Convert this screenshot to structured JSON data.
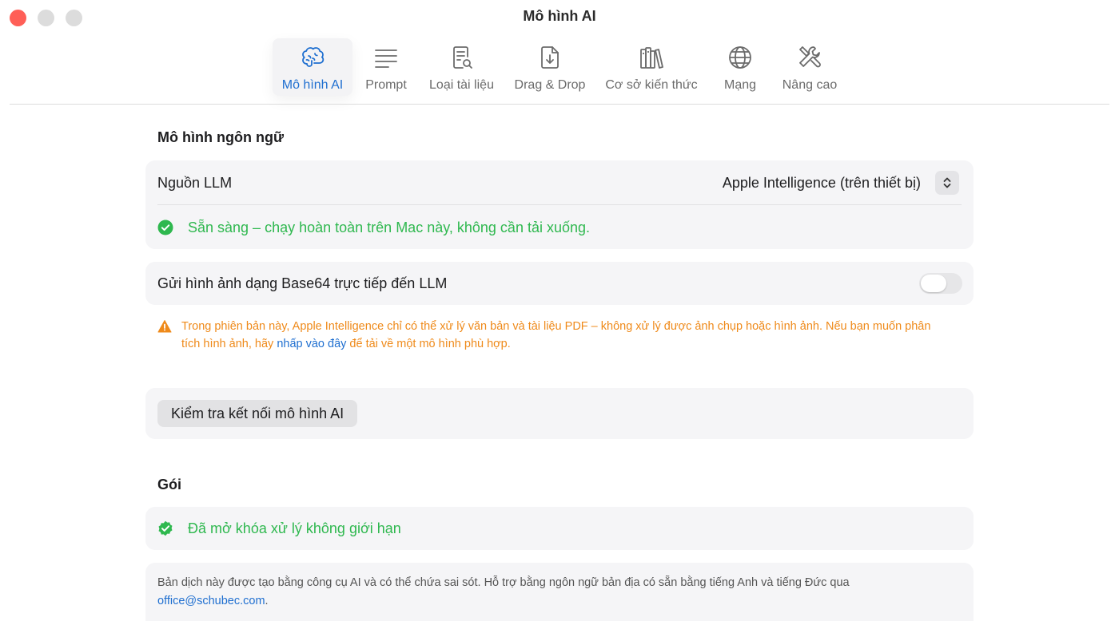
{
  "window": {
    "title": "Mô hình AI"
  },
  "toolbar": {
    "tabs": [
      {
        "label": "Mô hình AI",
        "icon": "brain-icon",
        "active": true
      },
      {
        "label": "Prompt",
        "icon": "text-lines-icon",
        "active": false
      },
      {
        "label": "Loại tài liệu",
        "icon": "document-search-icon",
        "active": false
      },
      {
        "label": "Drag & Drop",
        "icon": "document-download-icon",
        "active": false
      },
      {
        "label": "Cơ sở kiến thức",
        "icon": "books-icon",
        "active": false
      },
      {
        "label": "Mạng",
        "icon": "globe-icon",
        "active": false
      },
      {
        "label": "Nâng cao",
        "icon": "tools-icon",
        "active": false
      }
    ]
  },
  "language_model": {
    "section_title": "Mô hình ngôn ngữ",
    "llm_source_label": "Nguồn LLM",
    "llm_source_value": "Apple Intelligence (trên thiết bị)",
    "status_text": "Sẵn sàng – chạy hoàn toàn trên Mac này, không cần tải xuống.",
    "base64_label": "Gửi hình ảnh dạng Base64 trực tiếp đến LLM",
    "base64_enabled": false,
    "warning_part1": "Trong phiên bản này, Apple Intelligence chỉ có thể xử lý văn bản và tài liệu PDF – không xử lý được ảnh chụp hoặc hình ảnh. Nếu bạn muốn phân tích hình ảnh, hãy ",
    "warning_link": "nhấp vào đây",
    "warning_part2": " để tải về một mô hình phù hợp.",
    "test_button": "Kiểm tra kết nối mô hình AI"
  },
  "package": {
    "section_title": "Gói",
    "status_text": "Đã mở khóa xử lý không giới hạn"
  },
  "footer": {
    "text": "Bản dịch này được tạo bằng công cụ AI và có thể chứa sai sót. Hỗ trợ bằng ngôn ngữ bản địa có sẵn bằng tiếng Anh và tiếng Đức qua ",
    "email": "office@schubec.com",
    "suffix": "."
  },
  "colors": {
    "accent": "#1f6fd0",
    "success": "#2fb84f",
    "warning": "#ef8a1a",
    "close": "#ff5f57"
  }
}
